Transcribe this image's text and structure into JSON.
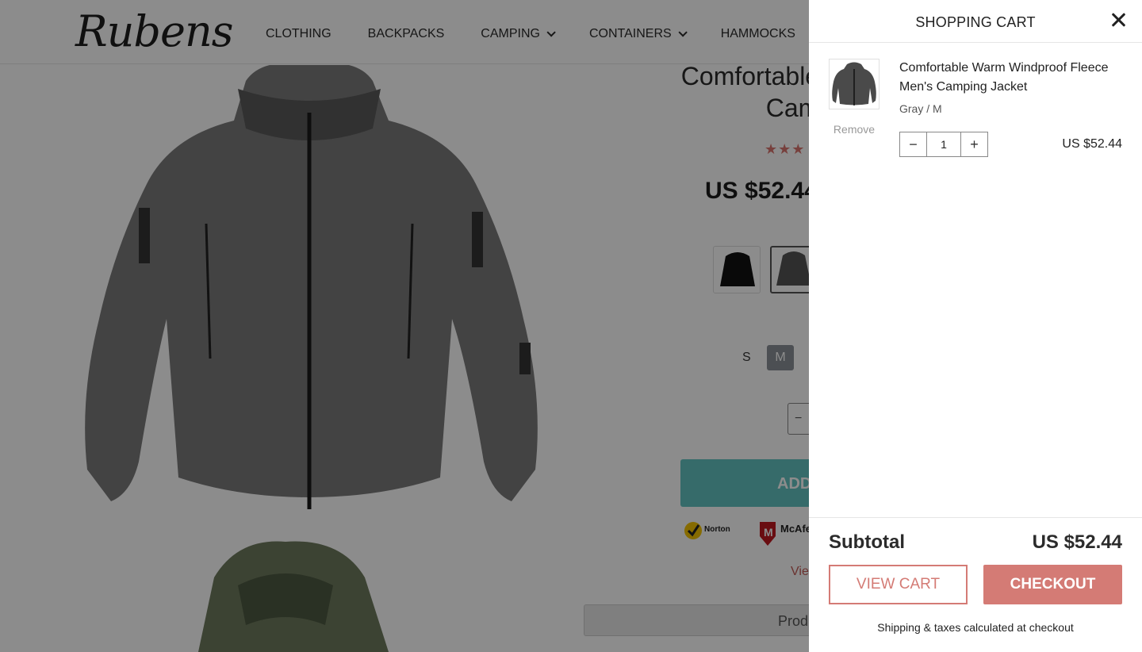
{
  "store": {
    "logo_text": "Rubens",
    "nav": [
      {
        "label": "CLOTHING",
        "dropdown": false
      },
      {
        "label": "BACKPACKS",
        "dropdown": false
      },
      {
        "label": "CAMPING",
        "dropdown": true
      },
      {
        "label": "CONTAINERS",
        "dropdown": true
      },
      {
        "label": "HAMMOCKS",
        "dropdown": false
      }
    ]
  },
  "product": {
    "title_visible": "Comfortable Warm W… Campi…",
    "title_line1": "Comfortable Warm W",
    "title_line2": "Campi",
    "stars_text": "★★★",
    "price_visible": "US $52.44",
    "size_options": [
      "S",
      "M"
    ],
    "selected_size": "M",
    "qty_minus": "−",
    "add_button_visible": "ADD",
    "view_link_visible": "Vie",
    "tab_visible": "Prod",
    "norton_text": "Norton",
    "mcafee_text": "McAfe"
  },
  "cart": {
    "title": "SHOPPING CART",
    "close_icon": "close-icon",
    "items": [
      {
        "name": "Comfortable Warm Windproof Fleece Men's Camping Jacket",
        "variant": "Gray / M",
        "remove_label": "Remove",
        "quantity": "1",
        "minus": "−",
        "plus": "+",
        "price": "US $52.44"
      }
    ],
    "subtotal_label": "Subtotal",
    "subtotal_value": "US $52.44",
    "view_cart_label": "VIEW CART",
    "checkout_label": "CHECKOUT",
    "shipping_note": "Shipping & taxes calculated at checkout"
  },
  "colors": {
    "accent": "#d47b75",
    "teal": "#63c4c2",
    "overlay": "rgba(0,0,0,0.45)"
  }
}
